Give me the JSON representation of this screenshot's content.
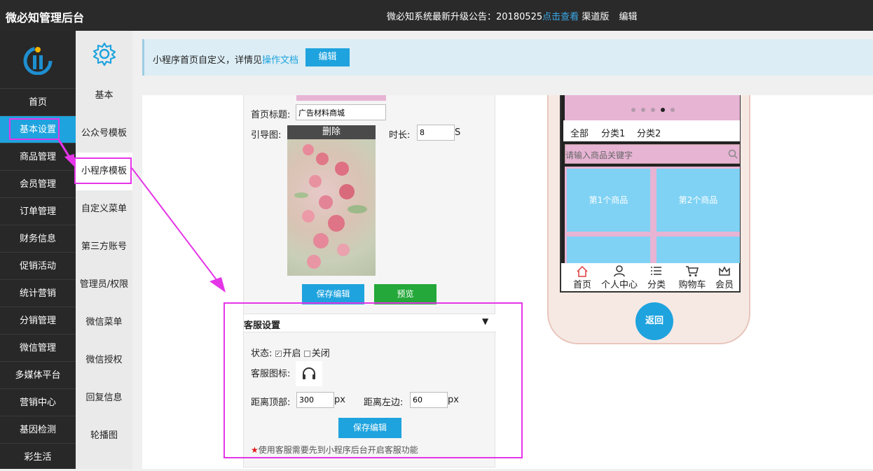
{
  "header": {
    "title": "微必知管理后台",
    "notice_prefix": "微必知系统最新升级公告：20180525",
    "notice_link": "点击查看",
    "channel": "渠道版",
    "edit": "编辑"
  },
  "sidebar": {
    "items": [
      {
        "label": "首页"
      },
      {
        "label": "基本设置"
      },
      {
        "label": "商品管理"
      },
      {
        "label": "会员管理"
      },
      {
        "label": "订单管理"
      },
      {
        "label": "财务信息"
      },
      {
        "label": "促销活动"
      },
      {
        "label": "统计营销"
      },
      {
        "label": "分销管理"
      },
      {
        "label": "微信管理"
      },
      {
        "label": "多媒体平台"
      },
      {
        "label": "营销中心"
      },
      {
        "label": "基因检测"
      },
      {
        "label": "彩生活"
      }
    ]
  },
  "subsidebar": {
    "items": [
      {
        "label": "基本"
      },
      {
        "label": "公众号模板"
      },
      {
        "label": "小程序模板"
      },
      {
        "label": "自定义菜单"
      },
      {
        "label": "第三方账号"
      },
      {
        "label": "管理员/权限"
      },
      {
        "label": "微信菜单"
      },
      {
        "label": "微信授权"
      },
      {
        "label": "回复信息"
      },
      {
        "label": "轮播图"
      }
    ]
  },
  "banner": {
    "text": "小程序首页自定义，详情见",
    "link": "操作文档",
    "button": "编辑"
  },
  "form": {
    "home_title_label": "首页标题:",
    "home_title_value": "广告材料商城",
    "guide_label": "引导图:",
    "delete": "删除",
    "duration_label": "时长:",
    "duration_value": "8",
    "duration_unit": "S",
    "save_button": "保存编辑",
    "preview_button": "预览"
  },
  "kefu": {
    "title": "客服设置",
    "toggle": "▼",
    "status_label": "状态:",
    "on_label": "开启",
    "off_label": "关闭",
    "icon_label": "客服图标:",
    "top_label": "距离顶部:",
    "top_value": "300",
    "left_label": "距离左边:",
    "left_value": "60",
    "unit": "px",
    "save_button": "保存编辑",
    "note_star": "★",
    "note": "使用客服需要先到小程序后台开启客服功能"
  },
  "phone": {
    "tabs": [
      "全部",
      "分类1",
      "分类2"
    ],
    "search_placeholder": "请输入商品关键字",
    "products": [
      "第1个商品",
      "第2个商品"
    ],
    "tabbar": [
      "首页",
      "个人中心",
      "分类",
      "购物车",
      "会员"
    ],
    "back": "返回"
  },
  "colors": {
    "accent": "#1ea3de",
    "highlight": "#e535e8",
    "green": "#24a83a",
    "pink": "#e7b4d4"
  }
}
